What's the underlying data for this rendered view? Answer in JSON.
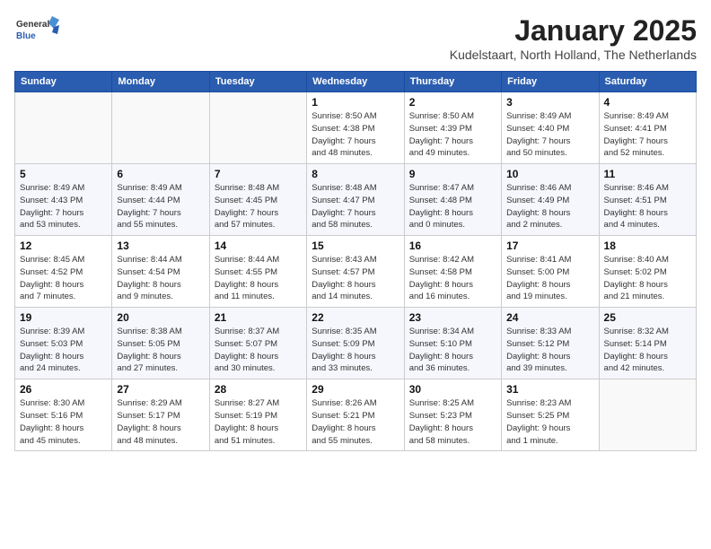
{
  "logo": {
    "line1": "General",
    "line2": "Blue"
  },
  "title": "January 2025",
  "location": "Kudelstaart, North Holland, The Netherlands",
  "days_header": [
    "Sunday",
    "Monday",
    "Tuesday",
    "Wednesday",
    "Thursday",
    "Friday",
    "Saturday"
  ],
  "weeks": [
    [
      {
        "day": "",
        "info": ""
      },
      {
        "day": "",
        "info": ""
      },
      {
        "day": "",
        "info": ""
      },
      {
        "day": "1",
        "info": "Sunrise: 8:50 AM\nSunset: 4:38 PM\nDaylight: 7 hours\nand 48 minutes."
      },
      {
        "day": "2",
        "info": "Sunrise: 8:50 AM\nSunset: 4:39 PM\nDaylight: 7 hours\nand 49 minutes."
      },
      {
        "day": "3",
        "info": "Sunrise: 8:49 AM\nSunset: 4:40 PM\nDaylight: 7 hours\nand 50 minutes."
      },
      {
        "day": "4",
        "info": "Sunrise: 8:49 AM\nSunset: 4:41 PM\nDaylight: 7 hours\nand 52 minutes."
      }
    ],
    [
      {
        "day": "5",
        "info": "Sunrise: 8:49 AM\nSunset: 4:43 PM\nDaylight: 7 hours\nand 53 minutes."
      },
      {
        "day": "6",
        "info": "Sunrise: 8:49 AM\nSunset: 4:44 PM\nDaylight: 7 hours\nand 55 minutes."
      },
      {
        "day": "7",
        "info": "Sunrise: 8:48 AM\nSunset: 4:45 PM\nDaylight: 7 hours\nand 57 minutes."
      },
      {
        "day": "8",
        "info": "Sunrise: 8:48 AM\nSunset: 4:47 PM\nDaylight: 7 hours\nand 58 minutes."
      },
      {
        "day": "9",
        "info": "Sunrise: 8:47 AM\nSunset: 4:48 PM\nDaylight: 8 hours\nand 0 minutes."
      },
      {
        "day": "10",
        "info": "Sunrise: 8:46 AM\nSunset: 4:49 PM\nDaylight: 8 hours\nand 2 minutes."
      },
      {
        "day": "11",
        "info": "Sunrise: 8:46 AM\nSunset: 4:51 PM\nDaylight: 8 hours\nand 4 minutes."
      }
    ],
    [
      {
        "day": "12",
        "info": "Sunrise: 8:45 AM\nSunset: 4:52 PM\nDaylight: 8 hours\nand 7 minutes."
      },
      {
        "day": "13",
        "info": "Sunrise: 8:44 AM\nSunset: 4:54 PM\nDaylight: 8 hours\nand 9 minutes."
      },
      {
        "day": "14",
        "info": "Sunrise: 8:44 AM\nSunset: 4:55 PM\nDaylight: 8 hours\nand 11 minutes."
      },
      {
        "day": "15",
        "info": "Sunrise: 8:43 AM\nSunset: 4:57 PM\nDaylight: 8 hours\nand 14 minutes."
      },
      {
        "day": "16",
        "info": "Sunrise: 8:42 AM\nSunset: 4:58 PM\nDaylight: 8 hours\nand 16 minutes."
      },
      {
        "day": "17",
        "info": "Sunrise: 8:41 AM\nSunset: 5:00 PM\nDaylight: 8 hours\nand 19 minutes."
      },
      {
        "day": "18",
        "info": "Sunrise: 8:40 AM\nSunset: 5:02 PM\nDaylight: 8 hours\nand 21 minutes."
      }
    ],
    [
      {
        "day": "19",
        "info": "Sunrise: 8:39 AM\nSunset: 5:03 PM\nDaylight: 8 hours\nand 24 minutes."
      },
      {
        "day": "20",
        "info": "Sunrise: 8:38 AM\nSunset: 5:05 PM\nDaylight: 8 hours\nand 27 minutes."
      },
      {
        "day": "21",
        "info": "Sunrise: 8:37 AM\nSunset: 5:07 PM\nDaylight: 8 hours\nand 30 minutes."
      },
      {
        "day": "22",
        "info": "Sunrise: 8:35 AM\nSunset: 5:09 PM\nDaylight: 8 hours\nand 33 minutes."
      },
      {
        "day": "23",
        "info": "Sunrise: 8:34 AM\nSunset: 5:10 PM\nDaylight: 8 hours\nand 36 minutes."
      },
      {
        "day": "24",
        "info": "Sunrise: 8:33 AM\nSunset: 5:12 PM\nDaylight: 8 hours\nand 39 minutes."
      },
      {
        "day": "25",
        "info": "Sunrise: 8:32 AM\nSunset: 5:14 PM\nDaylight: 8 hours\nand 42 minutes."
      }
    ],
    [
      {
        "day": "26",
        "info": "Sunrise: 8:30 AM\nSunset: 5:16 PM\nDaylight: 8 hours\nand 45 minutes."
      },
      {
        "day": "27",
        "info": "Sunrise: 8:29 AM\nSunset: 5:17 PM\nDaylight: 8 hours\nand 48 minutes."
      },
      {
        "day": "28",
        "info": "Sunrise: 8:27 AM\nSunset: 5:19 PM\nDaylight: 8 hours\nand 51 minutes."
      },
      {
        "day": "29",
        "info": "Sunrise: 8:26 AM\nSunset: 5:21 PM\nDaylight: 8 hours\nand 55 minutes."
      },
      {
        "day": "30",
        "info": "Sunrise: 8:25 AM\nSunset: 5:23 PM\nDaylight: 8 hours\nand 58 minutes."
      },
      {
        "day": "31",
        "info": "Sunrise: 8:23 AM\nSunset: 5:25 PM\nDaylight: 9 hours\nand 1 minute."
      },
      {
        "day": "",
        "info": ""
      }
    ]
  ]
}
